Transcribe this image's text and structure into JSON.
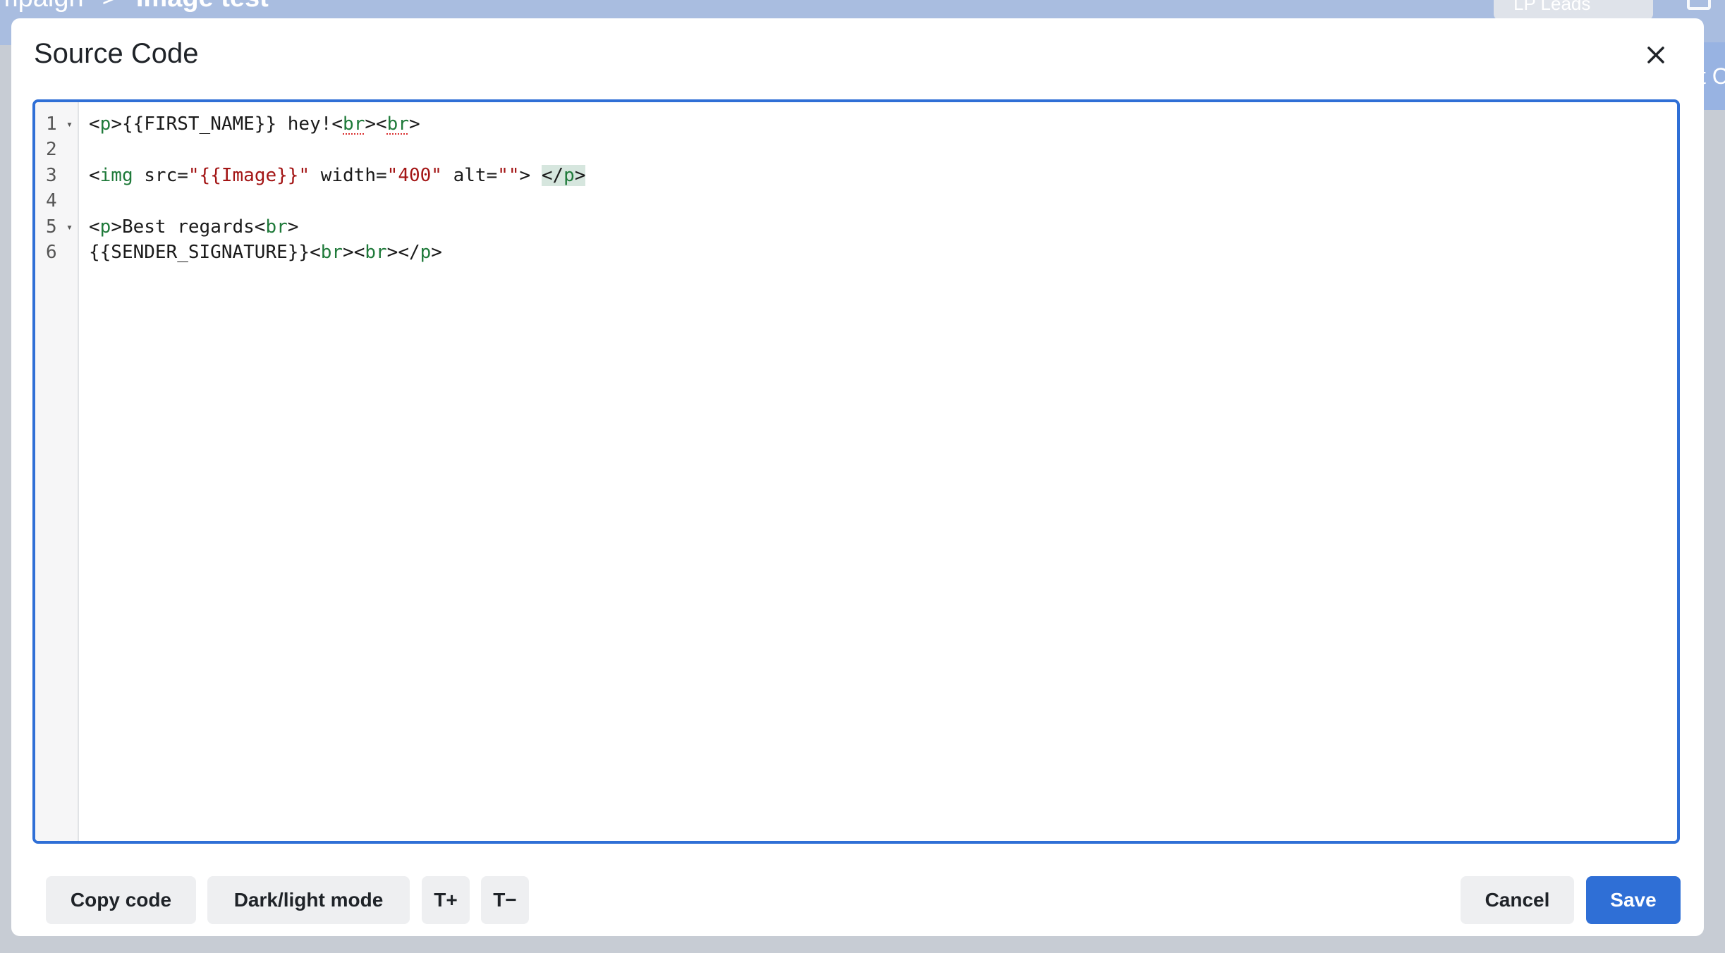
{
  "background": {
    "breadcrumb_parent": "mpaign",
    "breadcrumb_separator": ">",
    "breadcrumb_current": "Image test",
    "dropdown_label": "LP Leads",
    "right_button_text": "t C"
  },
  "modal": {
    "title": "Source Code",
    "close_icon": "close-icon"
  },
  "editor": {
    "line_numbers": [
      "1",
      "2",
      "3",
      "4",
      "5",
      "6"
    ],
    "fold_marker": "▾",
    "lines": {
      "l1": {
        "a": "<",
        "b": "p",
        "c": ">{{FIRST_NAME}} hey!<",
        "d": "br",
        "e": "><",
        "f": "br",
        "g": ">"
      },
      "l3": {
        "a": "<",
        "b": "img",
        "c": " src=",
        "d": "\"{{Image}}\"",
        "e": " width=",
        "f": "\"400\"",
        "g": " alt=",
        "h": "\"\"",
        "i": "> ",
        "j": "</",
        "k": "p",
        "l": ">"
      },
      "l5": {
        "a": "<",
        "b": "p",
        "c": ">Best regards<",
        "d": "br",
        "e": ">"
      },
      "l6": {
        "a": "{{SENDER_SIGNATURE}}<",
        "b": "br",
        "c": "><",
        "d": "br",
        "e": "></",
        "f": "p",
        "g": ">"
      }
    },
    "grammarly_icons": [
      "grammarly-bulb-icon",
      "grammarly-g-icon"
    ]
  },
  "footer": {
    "copy_code": "Copy code",
    "dark_light": "Dark/light mode",
    "font_increase": "T+",
    "font_decrease": "T−",
    "cancel": "Cancel",
    "save": "Save"
  },
  "colors": {
    "accent": "#2f6fd6",
    "tag": "#1f7a3a",
    "string": "#a31515"
  }
}
